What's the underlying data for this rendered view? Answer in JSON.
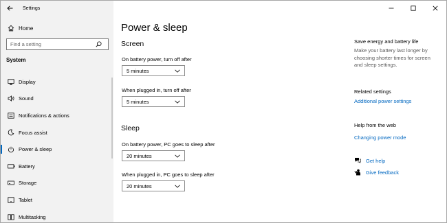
{
  "window": {
    "title": "Settings"
  },
  "sidebar": {
    "home_label": "Home",
    "search_placeholder": "Find a setting",
    "section_header": "System",
    "items": [
      {
        "label": "Display",
        "icon": "display-icon"
      },
      {
        "label": "Sound",
        "icon": "sound-icon"
      },
      {
        "label": "Notifications & actions",
        "icon": "notifications-icon"
      },
      {
        "label": "Focus assist",
        "icon": "focus-assist-icon"
      },
      {
        "label": "Power & sleep",
        "icon": "power-icon",
        "selected": true
      },
      {
        "label": "Battery",
        "icon": "battery-icon"
      },
      {
        "label": "Storage",
        "icon": "storage-icon"
      },
      {
        "label": "Tablet",
        "icon": "tablet-icon"
      },
      {
        "label": "Multitasking",
        "icon": "multitasking-icon"
      }
    ]
  },
  "main": {
    "page_title": "Power & sleep",
    "screen": {
      "heading": "Screen",
      "battery_label": "On battery power, turn off after",
      "battery_value": "5 minutes",
      "plugged_label": "When plugged in, turn off after",
      "plugged_value": "5 minutes"
    },
    "sleep": {
      "heading": "Sleep",
      "battery_label": "On battery power, PC goes to sleep after",
      "battery_value": "20 minutes",
      "plugged_label": "When plugged in, PC goes to sleep after",
      "plugged_value": "20 minutes"
    }
  },
  "right": {
    "save_heading": "Save energy and battery life",
    "save_text": "Make your battery last longer by choosing shorter times for screen and sleep settings.",
    "related_heading": "Related settings",
    "related_link": "Additional power settings",
    "help_heading": "Help from the web",
    "help_link": "Changing power mode",
    "get_help": "Get help",
    "give_feedback": "Give feedback"
  },
  "colors": {
    "accent": "#0067c0",
    "sidebar_bg": "#f2f2f2"
  }
}
